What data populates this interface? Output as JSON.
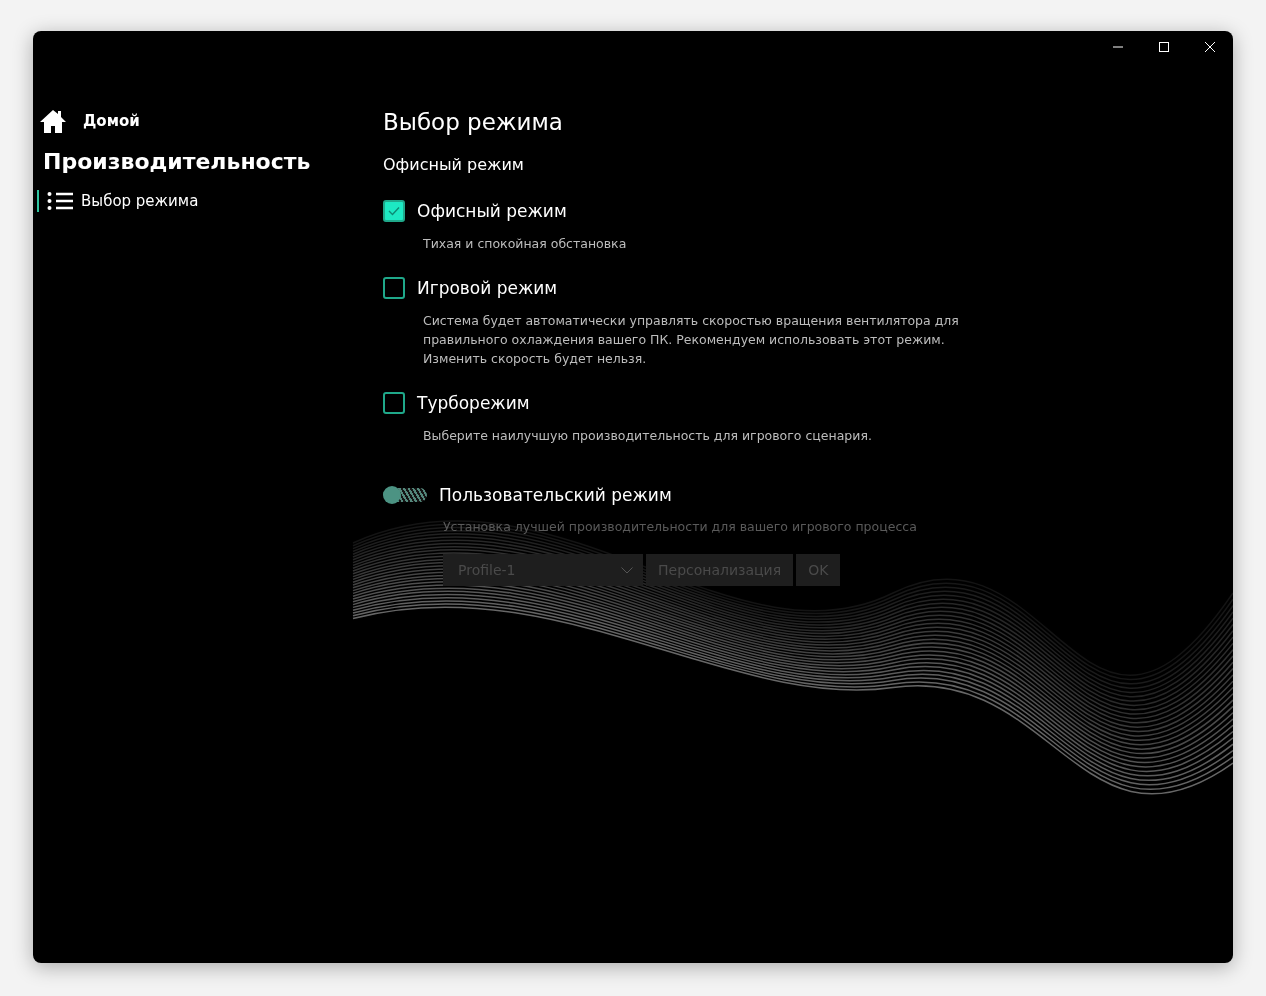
{
  "sidebar": {
    "home": "Домой",
    "section": "Производительность",
    "items": [
      {
        "label": "Выбор режима",
        "selected": true
      }
    ]
  },
  "main": {
    "title": "Выбор режима",
    "current": "Офисный режим",
    "modes": [
      {
        "label": "Офисный режим",
        "description": "Тихая и спокойная обстановка",
        "checked": true
      },
      {
        "label": "Игровой режим",
        "description": "Система будет автоматически управлять скоростью вращения вентилятора для правильного охлаждения вашего ПК. Рекомендуем использовать этот режим. Изменить скорость будет нельзя.",
        "checked": false
      },
      {
        "label": "Турборежим",
        "description": "Выберите наилучшую производительность для игрового сценария.",
        "checked": false
      }
    ],
    "custom": {
      "label": "Пользовательский режим",
      "description": "Установка лучшей производительности для вашего игрового процесса",
      "on": false,
      "disabled": true,
      "profile": "Profile-1",
      "personalize": "Персонализация",
      "ok": "OK"
    }
  }
}
